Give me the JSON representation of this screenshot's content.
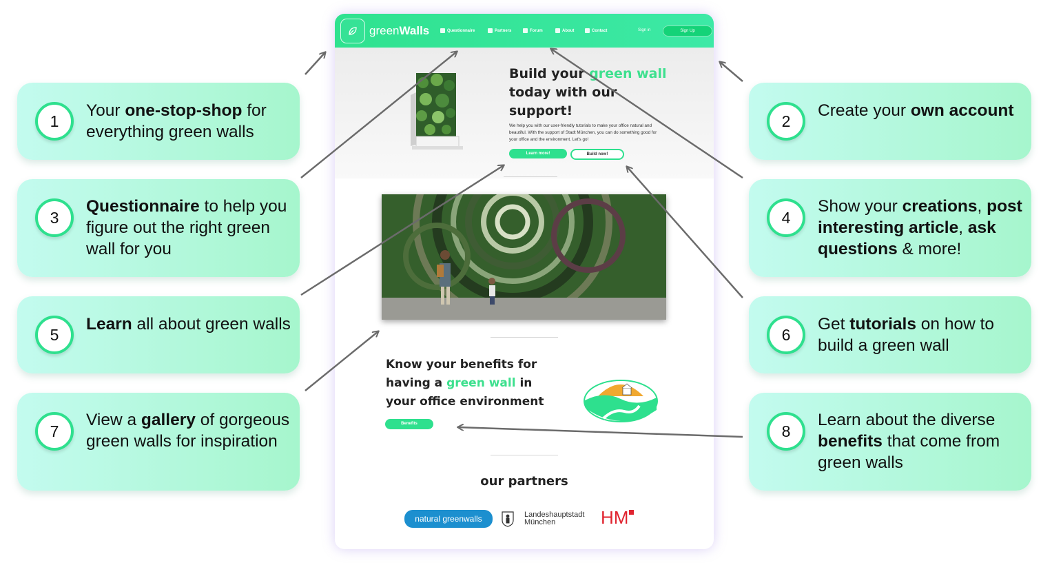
{
  "site": {
    "brand_light": "green",
    "brand_bold": "Walls",
    "nav": [
      "Questionnaire",
      "Partners",
      "Forum",
      "About",
      "Contact"
    ],
    "sign_in": "Sign in",
    "sign_up": "Sign Up"
  },
  "hero": {
    "title_pre": "Build your ",
    "title_green": "green wall",
    "title_post": " today with our support!",
    "description": "We help you with our user-friendly tutorials to make your office natural and beautiful. With the support of Stadt München, you can do something good for your office and the environment. Let's go!",
    "learn_more": "Learn more!",
    "build_now": "Build now!"
  },
  "benefits": {
    "title_pre": "Know your benefits for having a ",
    "title_green": "green wall",
    "title_post": " in your office environment",
    "button": "Benefits"
  },
  "partners": {
    "title": "our partners",
    "p1": "natural greenwalls",
    "p2_line1": "Landeshauptstadt",
    "p2_line2": "München",
    "p3": "HM"
  },
  "callouts": {
    "c1": {
      "num": "1",
      "a": "Your ",
      "b": "one-stop-shop",
      "c": " for everything green walls"
    },
    "c2": {
      "num": "2",
      "a": "Create your ",
      "b": "own account",
      "c": ""
    },
    "c3": {
      "num": "3",
      "a": "",
      "b": "Questionnaire",
      "c": " to help you figure out the right green wall for you"
    },
    "c4": {
      "num": "4",
      "a": "Show your ",
      "b": "creations",
      "c": ", ",
      "d": "post interesting article",
      "e": ", ",
      "f": "ask questions",
      "g": " & more!"
    },
    "c5": {
      "num": "5",
      "a": "",
      "b": "Learn",
      "c": " all about green walls"
    },
    "c6": {
      "num": "6",
      "a": "Get ",
      "b": "tutorials",
      "c": " on how to build a green wall"
    },
    "c7": {
      "num": "7",
      "a": "View a ",
      "b": "gallery",
      "c": " of gorgeous green walls for inspiration"
    },
    "c8": {
      "num": "8",
      "a": "Learn about the diverse ",
      "b": "benefits",
      "c": " that come from green walls"
    }
  },
  "colors": {
    "accent": "#2ee08e",
    "callout_start": "#c3fbef",
    "callout_end": "#a6f6cd"
  }
}
